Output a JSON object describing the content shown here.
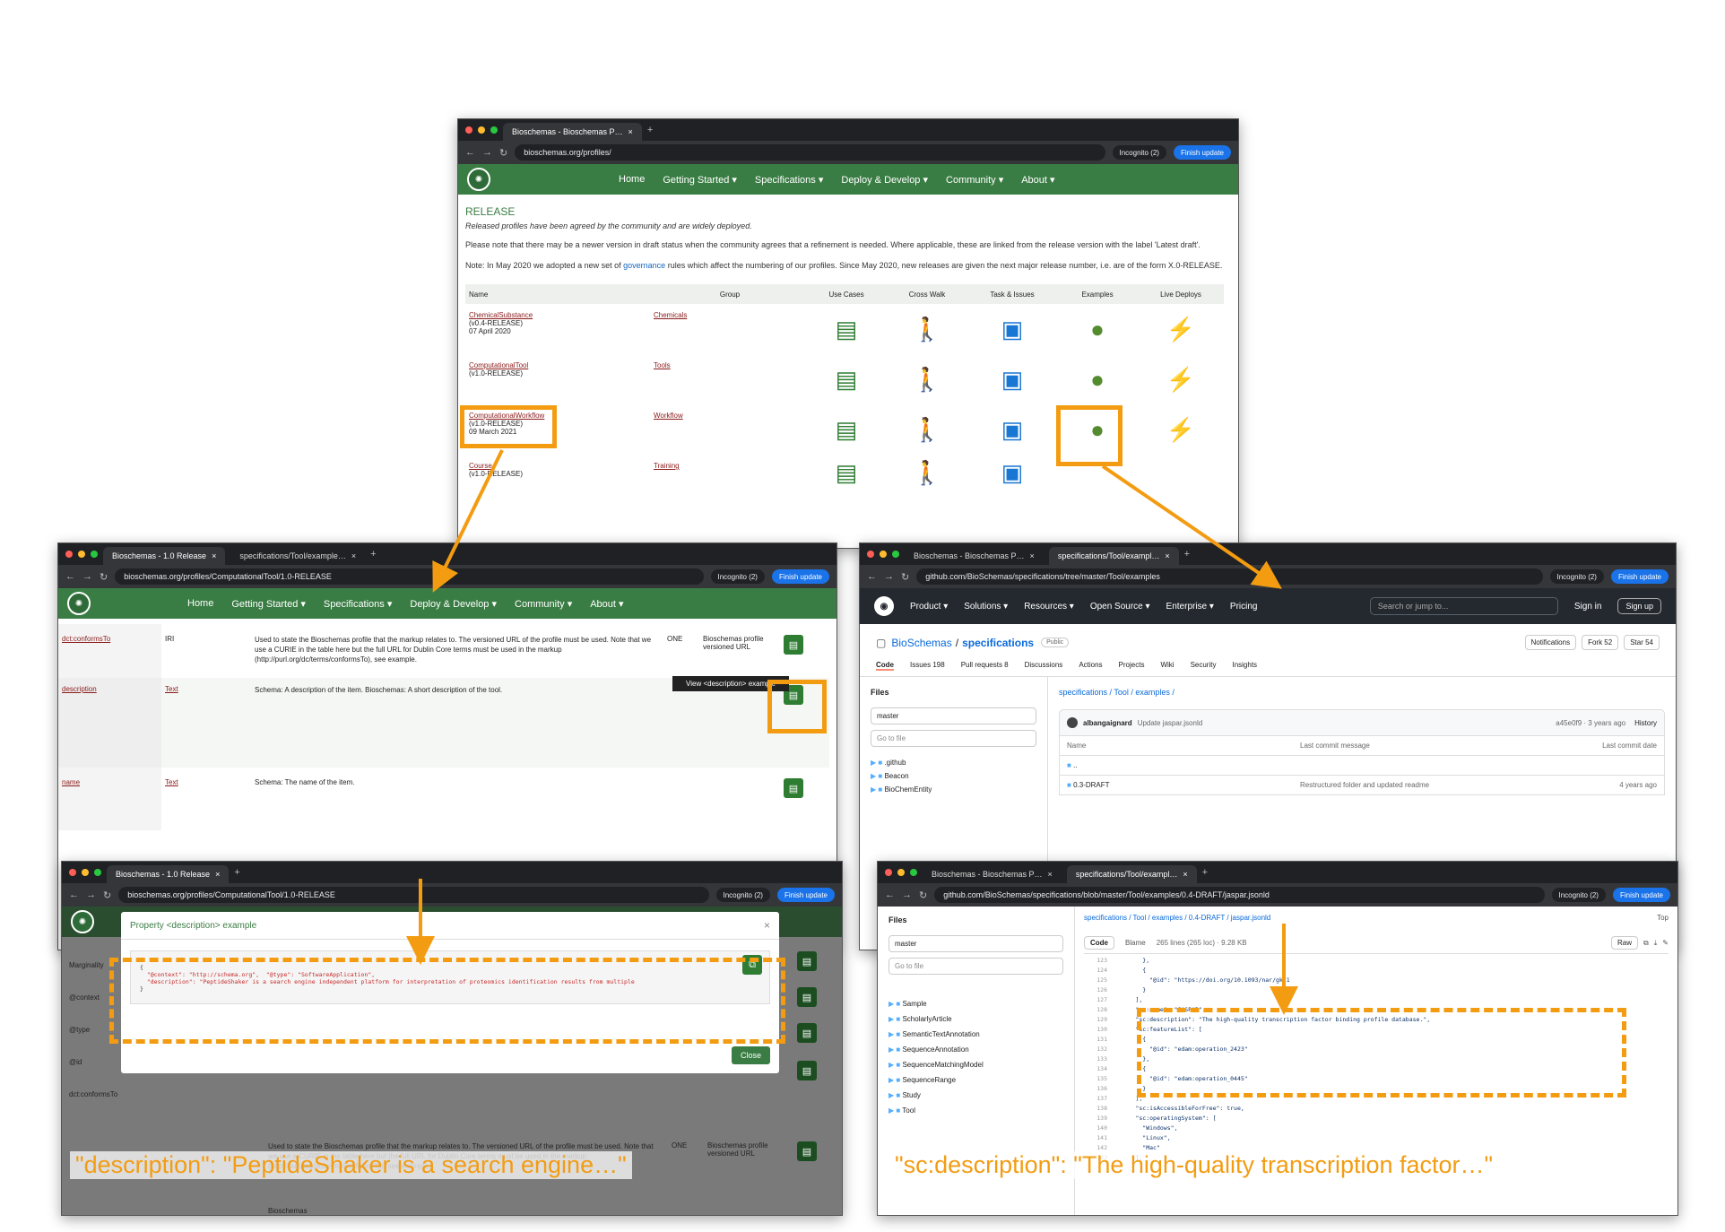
{
  "colors": {
    "accent": "#f39c12",
    "bioschemas_green": "#3a7d44",
    "github_dark": "#24292f",
    "chrome_dark": "#202124"
  },
  "win_main": {
    "tab_title": "Bioschemas - Bioschemas P…",
    "url": "bioschemas.org/profiles/",
    "incognito": "Incognito (2)",
    "finish_update": "Finish update",
    "nav": [
      "Home",
      "Getting Started ▾",
      "Specifications ▾",
      "Deploy & Develop ▾",
      "Community ▾",
      "About ▾"
    ],
    "heading": "RELEASE",
    "intro": "Released profiles have been agreed by the community and are widely deployed.",
    "note1": "Please note that there may be a newer version in draft status when the community agrees that a refinement is needed. Where applicable, these are linked from the release version with the label 'Latest draft'.",
    "note2_a": "Note: In May 2020 we adopted a new set of",
    "note2_link": "governance",
    "note2_b": "rules which affect the numbering of our profiles. Since May 2020, new releases are given the next major release number, i.e. are of the form X.0-RELEASE.",
    "table_headers": [
      "Name",
      "Group",
      "Use Cases",
      "Cross Walk",
      "Task & Issues",
      "Examples",
      "Live Deploys"
    ],
    "rows": [
      {
        "name": "ChemicalSubstance",
        "version": "(v0.4-RELEASE)",
        "date": "07 April 2020",
        "group": "Chemicals"
      },
      {
        "name": "ComputationalTool",
        "version": "(v1.0-RELEASE)",
        "date": "",
        "group": "Tools"
      },
      {
        "name": "ComputationalWorkflow",
        "version": "(v1.0-RELEASE)",
        "date": "09 March 2021",
        "group": "Workflow"
      },
      {
        "name": "Course",
        "version": "(v1.0-RELEASE)",
        "date": "",
        "group": "Training"
      }
    ]
  },
  "win_profile": {
    "tab_title": "Bioschemas - 1.0 Release",
    "tab2_title": "specifications/Tool/example…",
    "url": "bioschemas.org/profiles/ComputationalTool/1.0-RELEASE",
    "incognito": "Incognito (2)",
    "finish_update": "Finish update",
    "nav": [
      "Home",
      "Getting Started ▾",
      "Specifications ▾",
      "Deploy & Develop ▾",
      "Community ▾",
      "About ▾"
    ],
    "rows": [
      {
        "prop": "dct:conformsTo",
        "type": "IRI",
        "desc": "Used to state the Bioschemas profile that the markup relates to. The versioned URL of the profile must be used. Note that we use a CURIE in the table here but the full URL for Dublin Core terms must be used in the markup (http://purl.org/dc/terms/conformsTo), see example.",
        "card": "ONE",
        "extra": "Bioschemas profile versioned URL"
      },
      {
        "prop": "description",
        "type": "Text",
        "desc": "Schema: A description of the item. Bioschemas: A short description of the tool.",
        "card": "",
        "extra": ""
      },
      {
        "prop": "name",
        "type": "Text",
        "desc": "Schema: The name of the item.",
        "card": "",
        "extra": ""
      }
    ],
    "tooltip": "View <description> example"
  },
  "win_github": {
    "tab_title": "Bioschemas - Bioschemas P…",
    "tab2_title": "specifications/Tool/exampl…",
    "url": "github.com/BioSchemas/specifications/tree/master/Tool/examples",
    "incognito": "Incognito (2)",
    "finish_update": "Finish update",
    "gh_nav": [
      "Product ▾",
      "Solutions ▾",
      "Resources ▾",
      "Open Source ▾",
      "Enterprise ▾",
      "Pricing"
    ],
    "search": "Search or jump to...",
    "sign_in": "Sign in",
    "sign_up": "Sign up",
    "repo_owner": "BioSchemas",
    "repo_name": "specifications",
    "visibility": "Public",
    "repo_tabs": [
      "Code",
      "Issues 198",
      "Pull requests 8",
      "Discussions",
      "Actions",
      "Projects",
      "Wiki",
      "Security",
      "Insights"
    ],
    "notif": "Notifications",
    "fork": "Fork 52",
    "star": "Star 54",
    "files_label": "Files",
    "branch": "master",
    "goto_file": "Go to file",
    "breadcrumb": "specifications / Tool / examples /",
    "commit_user": "albangaignard",
    "commit_msg": "Update jaspar.jsonld",
    "commit_meta": "a45e0f9 · 3 years ago",
    "history": "History",
    "file_headers": [
      "Name",
      "Last commit message",
      "Last commit date"
    ],
    "tree": [
      ".github",
      "Beacon",
      "BioChemEntity"
    ],
    "files": [
      {
        "name": "..",
        "msg": "",
        "date": ""
      },
      {
        "name": "0.3-DRAFT",
        "msg": "Restructured folder and updated readme",
        "date": "4 years ago"
      }
    ]
  },
  "win_modal": {
    "tab_title": "Bioschemas - 1.0 Release",
    "url": "bioschemas.org/profiles/ComputationalTool/1.0-RELEASE",
    "incognito": "Incognito (2)",
    "finish_update": "Finish update",
    "modal_title": "Property <description> example",
    "code_line1": "{",
    "code_line2": "  \"@context\": \"http://schema.org\",  \"@type\": \"SoftwareApplication\",",
    "code_line3": "  \"description\": \"PeptideShaker is a search engine independent platform for interpretation of proteomics identification results from multiple",
    "code_line4": "}",
    "close": "Close",
    "bg_props": [
      "Marginality",
      "@context",
      "@type",
      "@id",
      "dct:conformsTo"
    ],
    "bg_desc": "Used to state the Bioschemas profile that the markup relates to. The versioned URL of the profile must be used. Note that we use a CURIE in the table here but the full URL for Dublin Core terms must be used in the markup (http://purl.org/dc/terms/conformsTo), see example.",
    "bg_card": "ONE",
    "bg_extra": "Bioschemas profile versioned URL",
    "bg_footer": "Bioschemas"
  },
  "win_json": {
    "tab_title": "Bioschemas - Bioschemas P…",
    "tab2_title": "specifications/Tool/exampl…",
    "url": "github.com/BioSchemas/specifications/blob/master/Tool/examples/0.4-DRAFT/jaspar.jsonld",
    "incognito": "Incognito (2)",
    "finish_update": "Finish update",
    "files_label": "Files",
    "branch": "master",
    "goto_file": "Go to file",
    "breadcrumb": "specifications / Tool / examples / 0.4-DRAFT / jaspar.jsonld",
    "top_label": "Top",
    "code_tab": "Code",
    "blame_tab": "Blame",
    "file_meta": "265 lines (265 loc) · 9.28 KB",
    "raw": "Raw",
    "tree": [
      "Sample",
      "ScholarlyArticle",
      "SemanticTextAnnotation",
      "SequenceAnnotation",
      "SequenceMatchingModel",
      "SequenceRange",
      "Study",
      "Tool"
    ],
    "line_numbers": [
      "123",
      "124",
      "125",
      "126",
      "127",
      "128",
      "129",
      "130",
      "131",
      "132",
      "133",
      "134",
      "135",
      "136",
      "137",
      "138",
      "139",
      "140",
      "141",
      "142",
      "143"
    ],
    "code": [
      "        },",
      "        {",
      "          \"@id\": \"https://doi.org/10.1093/nar/gkz1",
      "        }",
      "      ],",
      "      \"sc:name\": \"JASPAR\",",
      "      \"sc:description\": \"The high-quality transcription factor binding profile database.\",",
      "      \"sc:featureList\": [",
      "        {",
      "          \"@id\": \"edam:operation_2423\"",
      "        },",
      "        {",
      "          \"@id\": \"edam:operation_0445\"",
      "        }",
      "      ],",
      "      \"sc:isAccessibleForFree\": true,",
      "      \"sc:operatingSystem\": [",
      "        \"Windows\",",
      "        \"Linux\",",
      "        \"Mac\"",
      "      ],"
    ]
  },
  "captions": {
    "left": "\"description\": \"PeptideShaker is a search engine…\"",
    "right": "\"sc:description\": \"The high-quality transcription factor…\""
  }
}
